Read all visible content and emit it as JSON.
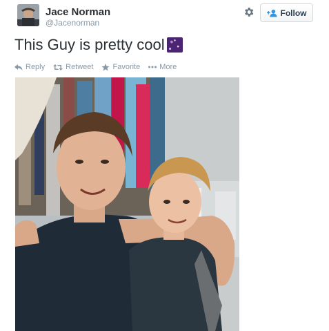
{
  "user": {
    "name": "Jace Norman",
    "handle": "@Jacenorman"
  },
  "follow_label": "Follow",
  "tweet": {
    "text": "This Guy is pretty cool",
    "emoji": "milky-way-emoji"
  },
  "actions": [
    {
      "label": "Reply",
      "icon": "reply-icon"
    },
    {
      "label": "Retweet",
      "icon": "retweet-icon"
    },
    {
      "label": "Favorite",
      "icon": "star-icon"
    },
    {
      "label": "More",
      "icon": "more-dots-icon"
    }
  ],
  "colors": {
    "text": "#292f33",
    "muted": "#8899a6",
    "follow_accent": "#3b94d9"
  },
  "photo": {
    "subject": "two-people-selfie"
  }
}
